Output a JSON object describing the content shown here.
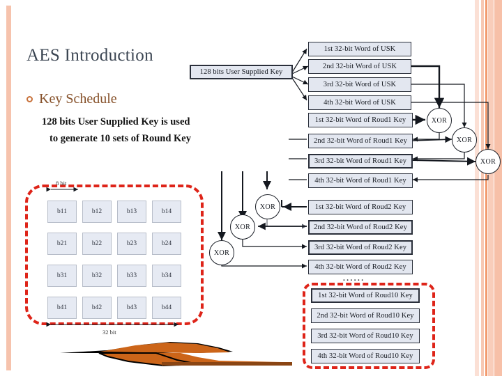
{
  "slide": {
    "title": "AES Introduction",
    "bullet": {
      "marker": "hollow-circle-bullet",
      "label": "Key Schedule"
    },
    "body_lines": [
      "128 bits User Supplied Key is used",
      "to generate 10 sets of Round Key"
    ]
  },
  "diagram": {
    "usk_box": "128 bits User Supplied Key",
    "usk_words": [
      "1st 32-bit Word of USK",
      "2nd 32-bit Word of USK",
      "3rd 32-bit Word of USK",
      "4th 32-bit Word of USK"
    ],
    "round1_words": [
      "1st 32-bit Word of Roud1 Key",
      "2nd 32-bit Word of Roud1 Key",
      "3rd 32-bit Word of Roud1 Key",
      "4th 32-bit Word of Roud1 Key"
    ],
    "round2_words": [
      "1st 32-bit Word of Roud2 Key",
      "2nd 32-bit Word of Roud2 Key",
      "3rd 32-bit Word of Roud2 Key",
      "4th 32-bit Word of Roud2 Key"
    ],
    "round10_words": [
      "1st 32-bit Word of Roud10 Key",
      "2nd 32-bit Word of Roud10 Key",
      "3rd 32-bit Word of Roud10 Key",
      "4th 32-bit Word of Roud10 Key"
    ],
    "xor_label": "XOR",
    "xor_count": 6,
    "ellipsis": "......"
  },
  "matrix": {
    "width_label": "8 bit",
    "total_label": "32 bit",
    "rows": [
      [
        "b11",
        "b12",
        "b13",
        "b14"
      ],
      [
        "b21",
        "b22",
        "b23",
        "b24"
      ],
      [
        "b31",
        "b32",
        "b33",
        "b34"
      ],
      [
        "b41",
        "b42",
        "b43",
        "b44"
      ]
    ]
  },
  "colors": {
    "accent_bar": "#f6c3ad",
    "accent_line": "#f29a6e",
    "dashed_red": "#de2419",
    "box_fill": "#e3e7f0",
    "bullet_text": "#86512a",
    "title_text": "#3b4552",
    "orange_shape": "#cc6519"
  }
}
